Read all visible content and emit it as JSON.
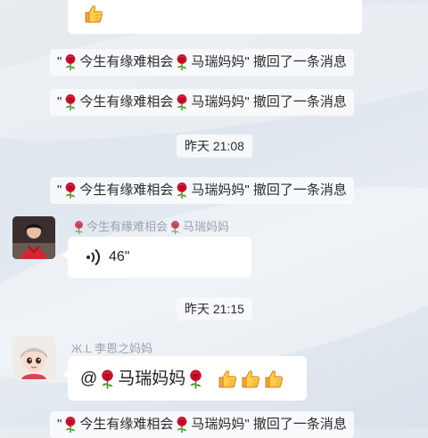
{
  "chat": {
    "recall_1": {
      "prefix": "\"",
      "name_a": "今生有缘难相会",
      "name_b": "马瑞妈妈",
      "suffix": "\" 撤回了一条消息"
    },
    "recall_2": {
      "prefix": "\"",
      "name_a": "今生有缘难相会",
      "name_b": "马瑞妈妈",
      "suffix": "\" 撤回了一条消息"
    },
    "time_1": "昨天 21:08",
    "recall_3": {
      "prefix": "\"",
      "name_a": "今生有缘难相会",
      "name_b": "马瑞妈妈",
      "suffix": "\" 撤回了一条消息"
    },
    "voice_message": {
      "sender_a": "今生有缘难相会",
      "sender_b": "马瑞妈妈",
      "duration": "46\""
    },
    "time_2": "昨天 21:15",
    "mention_message": {
      "sender": "Ж.L  李恩之妈妈",
      "at_sign": "@",
      "mention_name": "马瑞妈妈"
    },
    "recall_4": {
      "prefix": "\"",
      "name_a": "今生有缘难相会",
      "name_b": "马瑞妈妈",
      "suffix": "\" 撤回了一条消息"
    }
  },
  "colors": {
    "bubble": "#ffffff",
    "system_pill": "#f8fafc",
    "sender_name": "#9aa3ad",
    "text": "#222222"
  },
  "icons": [
    "thumbs-up-icon",
    "rose-icon",
    "voice-wave-icon",
    "avatar-photo-icon",
    "avatar-cartoon-icon"
  ]
}
